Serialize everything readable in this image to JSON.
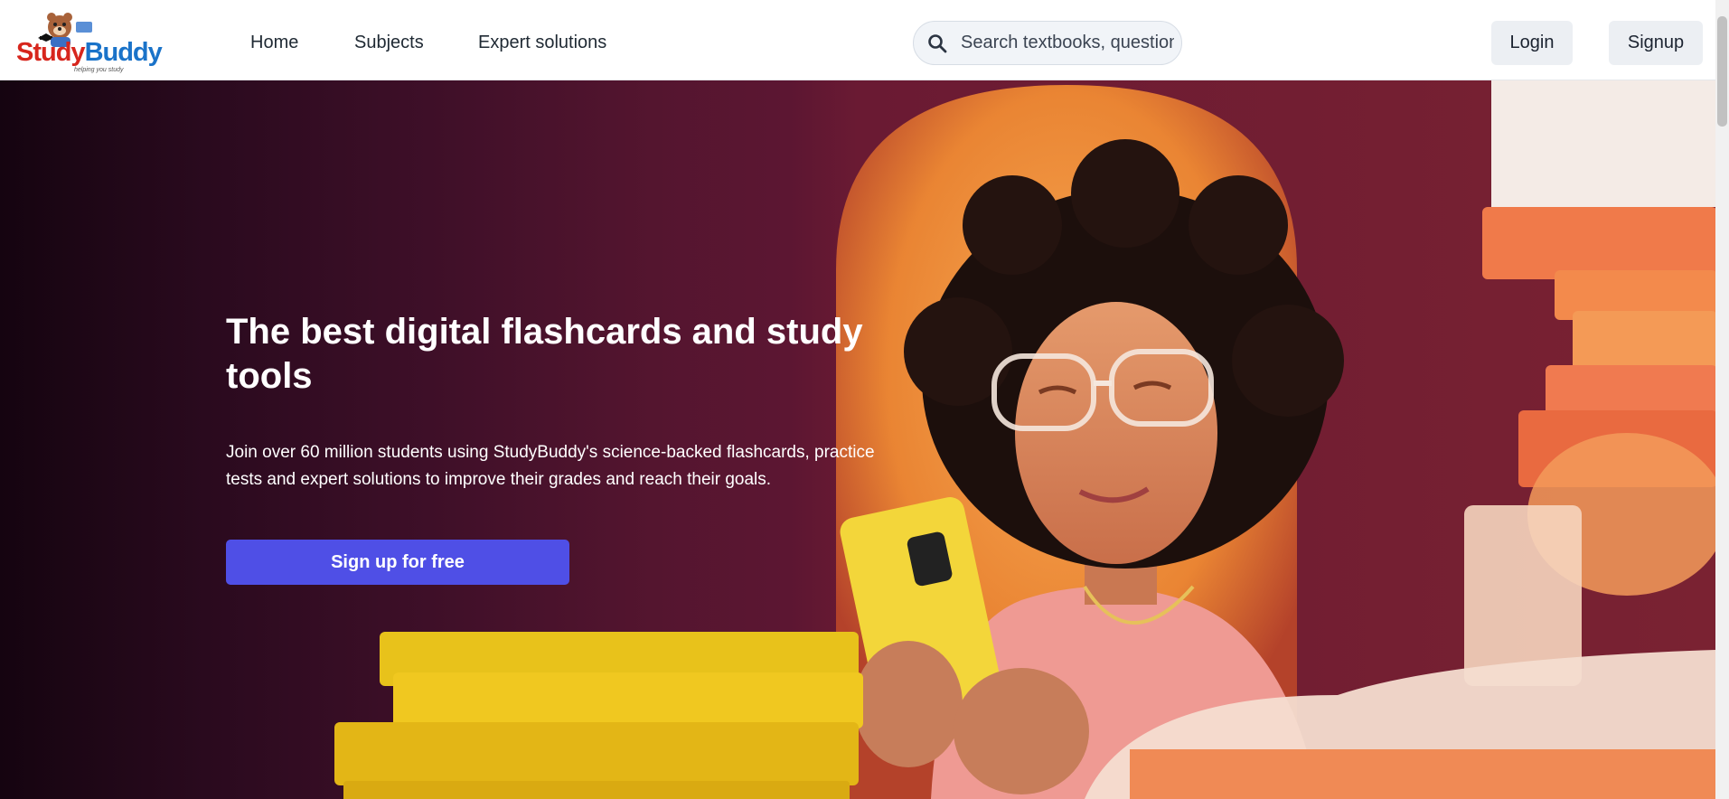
{
  "brand": {
    "name_part1": "Study",
    "name_part2": "Buddy",
    "tagline": "helping you study"
  },
  "nav": {
    "links": [
      "Home",
      "Subjects",
      "Expert solutions"
    ]
  },
  "search": {
    "placeholder": "Search textbooks, questions"
  },
  "auth": {
    "login_label": "Login",
    "signup_label": "Signup"
  },
  "hero": {
    "title": "The best digital flashcards and study tools",
    "subtitle": "Join over 60 million students using StudyBuddy's science-backed flashcards, practice tests and expert solutions to improve their grades and reach their goals.",
    "cta_label": "Sign up for free"
  },
  "colors": {
    "cta": "#4f4fe6",
    "brand_red": "#d7261d",
    "brand_blue": "#1a73c9",
    "hero_bg": "#5c1632"
  }
}
